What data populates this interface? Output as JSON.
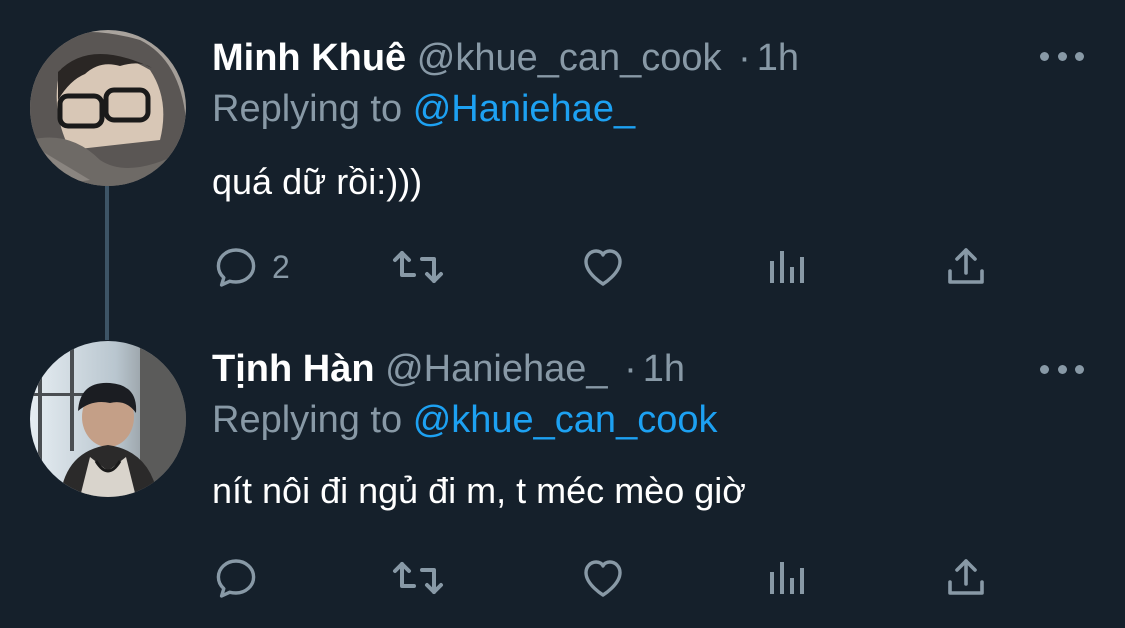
{
  "tweets": [
    {
      "display_name": "Minh Khuê",
      "handle": "@khue_can_cook",
      "separator": "·",
      "time": "1h",
      "replying_prefix": "Replying to",
      "replying_to": "@Haniehae_",
      "text": "quá dữ rồi:)))",
      "reply_count": "2",
      "icons": {
        "reply": "reply-icon",
        "retweet": "retweet-icon",
        "like": "heart-icon",
        "stats": "analytics-icon",
        "share": "share-icon",
        "more": "more-icon"
      }
    },
    {
      "display_name": "Tịnh Hàn",
      "handle": "@Haniehae_",
      "separator": "·",
      "time": "1h",
      "replying_prefix": "Replying to",
      "replying_to": "@khue_can_cook",
      "text": "nít nôi đi ngủ đi m, t méc mèo giờ",
      "reply_count": "",
      "icons": {
        "reply": "reply-icon",
        "retweet": "retweet-icon",
        "like": "heart-icon",
        "stats": "analytics-icon",
        "share": "share-icon",
        "more": "more-icon"
      }
    }
  ],
  "colors": {
    "background": "#15202b",
    "primary_text": "#ffffff",
    "secondary_text": "#8899a6",
    "accent": "#1da1f2",
    "thread_line": "#3d5466"
  }
}
